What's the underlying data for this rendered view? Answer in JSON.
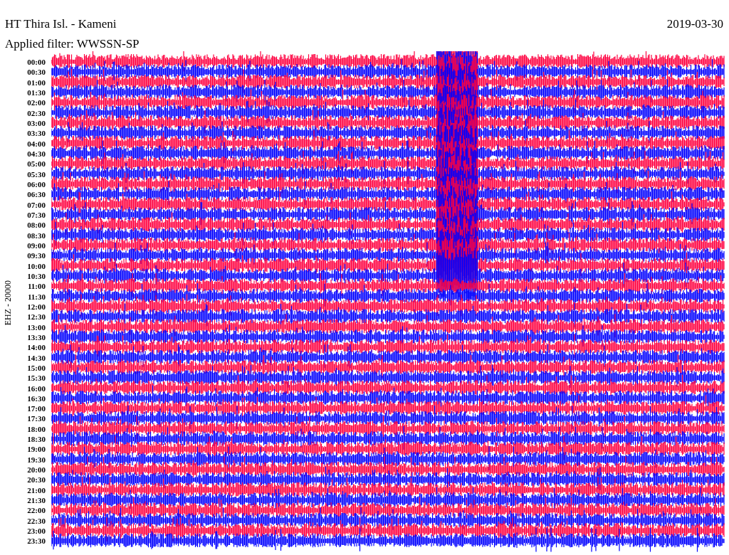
{
  "header": {
    "title": "HT Thira Isl. - Kameni",
    "date": "2019-03-30",
    "filter": "Applied filter: WWSSN-SP"
  },
  "channel_label": "EHZ - 20000",
  "rows": [
    {
      "time": "00:00",
      "color": "#ff0040"
    },
    {
      "time": "00:30",
      "color": "#0000ff"
    },
    {
      "time": "01:00",
      "color": "#ff0040"
    },
    {
      "time": "01:30",
      "color": "#0000ff"
    },
    {
      "time": "02:00",
      "color": "#ff0040"
    },
    {
      "time": "02:30",
      "color": "#0000ff"
    },
    {
      "time": "03:00",
      "color": "#ff0040"
    },
    {
      "time": "03:30",
      "color": "#0000ff"
    },
    {
      "time": "04:00",
      "color": "#ff0040"
    },
    {
      "time": "04:30",
      "color": "#0000ff"
    },
    {
      "time": "05:00",
      "color": "#ff0040"
    },
    {
      "time": "05:30",
      "color": "#0000ff"
    },
    {
      "time": "06:00",
      "color": "#ff0040"
    },
    {
      "time": "06:30",
      "color": "#0000ff"
    },
    {
      "time": "07:00",
      "color": "#ff0040"
    },
    {
      "time": "07:30",
      "color": "#0000ff"
    },
    {
      "time": "08:00",
      "color": "#ff0040"
    },
    {
      "time": "08:30",
      "color": "#0000ff"
    },
    {
      "time": "09:00",
      "color": "#ff0040"
    },
    {
      "time": "09:30",
      "color": "#0000ff"
    },
    {
      "time": "10:00",
      "color": "#ff0040"
    },
    {
      "time": "10:30",
      "color": "#0000ff"
    },
    {
      "time": "11:00",
      "color": "#ff0040"
    },
    {
      "time": "11:30",
      "color": "#0000ff"
    },
    {
      "time": "12:00",
      "color": "#ff0040"
    },
    {
      "time": "12:30",
      "color": "#0000ff"
    },
    {
      "time": "13:00",
      "color": "#ff0040"
    },
    {
      "time": "13:30",
      "color": "#0000ff"
    },
    {
      "time": "14:00",
      "color": "#ff0040"
    },
    {
      "time": "14:30",
      "color": "#0000ff"
    },
    {
      "time": "15:00",
      "color": "#ff0040"
    },
    {
      "time": "15:30",
      "color": "#0000ff"
    },
    {
      "time": "16:00",
      "color": "#ff0040"
    },
    {
      "time": "16:30",
      "color": "#0000ff"
    },
    {
      "time": "17:00",
      "color": "#ff0040"
    },
    {
      "time": "17:30",
      "color": "#0000ff"
    },
    {
      "time": "18:00",
      "color": "#ff0040"
    },
    {
      "time": "18:30",
      "color": "#0000ff"
    },
    {
      "time": "19:00",
      "color": "#ff0040"
    },
    {
      "time": "19:30",
      "color": "#0000ff"
    },
    {
      "time": "20:00",
      "color": "#ff0040"
    },
    {
      "time": "20:30",
      "color": "#0000ff"
    },
    {
      "time": "21:00",
      "color": "#ff0040"
    },
    {
      "time": "21:30",
      "color": "#0000ff"
    },
    {
      "time": "22:00",
      "color": "#ff0040"
    },
    {
      "time": "22:30",
      "color": "#0000ff"
    },
    {
      "time": "23:00",
      "color": "#ff0040"
    },
    {
      "time": "23:30",
      "color": "#0000ff"
    }
  ]
}
